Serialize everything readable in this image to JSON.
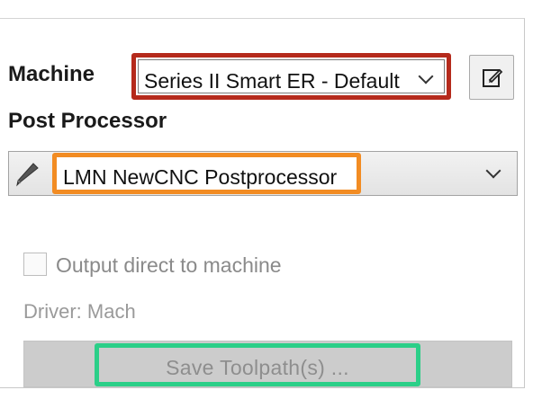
{
  "machine": {
    "label": "Machine",
    "selected": "Series II Smart ER - Default",
    "highlight_color": "#b52a1c",
    "edit_icon": "edit-icon"
  },
  "post_processor": {
    "label": "Post Processor",
    "selected": "LMN NewCNC Postprocessor",
    "highlight_color": "#f28c23",
    "icon": "pencil-icon"
  },
  "output": {
    "checkbox_label": "Output direct to machine",
    "checked": false,
    "driver_text": "Driver: Mach"
  },
  "save": {
    "label": "Save Toolpath(s) ...",
    "enabled": false,
    "highlight_color": "#2bcf88"
  }
}
